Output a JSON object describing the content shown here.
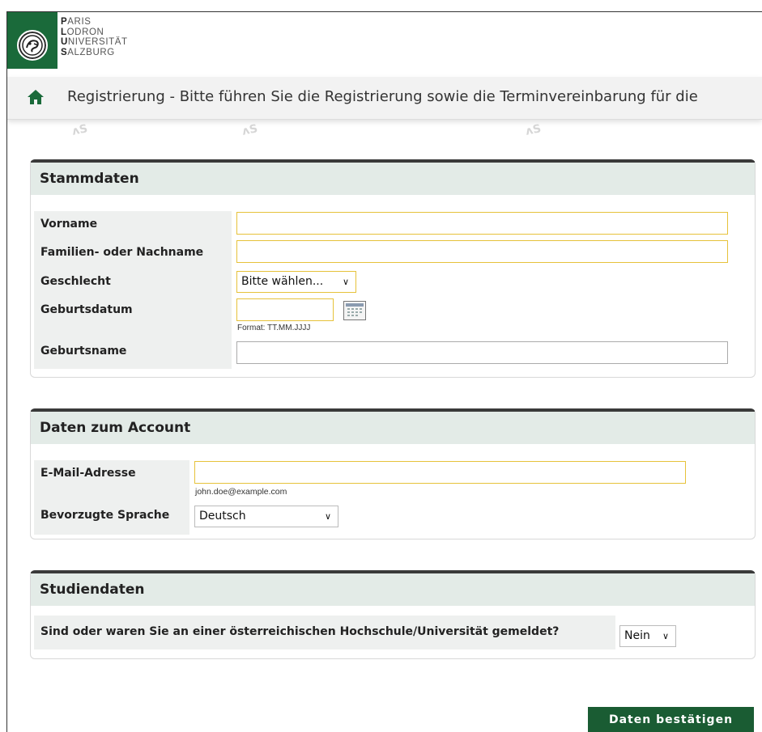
{
  "header": {
    "logo_lines": [
      {
        "initial": "P",
        "rest": "ARIS"
      },
      {
        "initial": "L",
        "rest": "ODRON"
      },
      {
        "initial": "U",
        "rest": "NIVERSITÄT"
      },
      {
        "initial": "S",
        "rest": "ALZBURG"
      }
    ],
    "page_title": "Registrierung - Bitte führen Sie die Registrierung sowie die Terminvereinbarung für die",
    "home_icon": "home-icon",
    "watermark_text": "ʌS"
  },
  "sections": {
    "stammdaten": {
      "title": "Stammdaten",
      "fields": {
        "vorname": {
          "label": "Vorname",
          "value": ""
        },
        "nachname": {
          "label": "Familien- oder Nachname",
          "value": ""
        },
        "geschlecht": {
          "label": "Geschlecht",
          "selected": "Bitte wählen..."
        },
        "geburtsdatum": {
          "label": "Geburtsdatum",
          "value": "",
          "hint": "Format: TT.MM.JJJJ",
          "icon": "calendar-icon"
        },
        "geburtsname": {
          "label": "Geburtsname",
          "value": ""
        }
      }
    },
    "account": {
      "title": "Daten zum Account",
      "fields": {
        "email": {
          "label": "E-Mail-Adresse",
          "value": "",
          "hint": "john.doe@example.com"
        },
        "sprache": {
          "label": "Bevorzugte Sprache",
          "selected": "Deutsch"
        }
      }
    },
    "studiendaten": {
      "title": "Studiendaten",
      "question": "Sind oder waren Sie an einer österreichischen Hochschule/Universität gemeldet?",
      "selected": "Nein"
    }
  },
  "actions": {
    "submit_label": "Daten bestätigen"
  },
  "colors": {
    "brand_green": "#1a5c33",
    "section_header_bg": "#e3ebe7",
    "required_border": "#e6c23a"
  }
}
